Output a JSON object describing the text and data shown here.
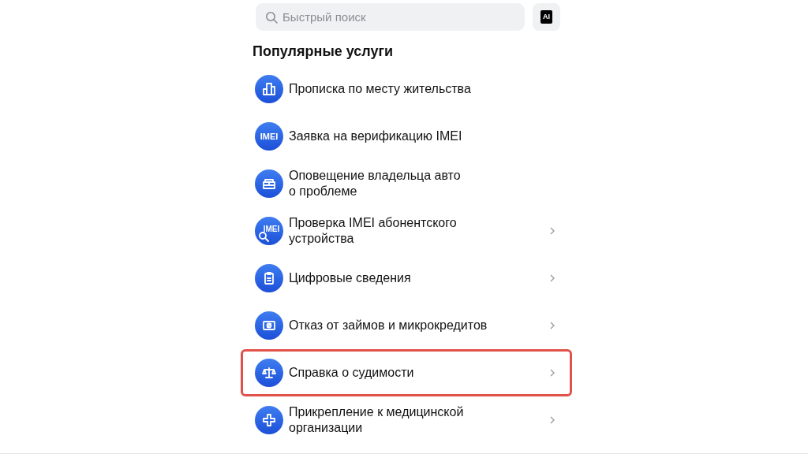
{
  "search": {
    "placeholder": "Быстрый поиск"
  },
  "ai_button": {
    "label": "AI"
  },
  "section_title": "Популярные услуги",
  "services": [
    {
      "lines": [
        "Прописка по месту жительства"
      ],
      "chevron": false,
      "highlighted": false
    },
    {
      "icon_label": "IMEI",
      "lines": [
        "Заявка на верификацию IMEI"
      ],
      "chevron": false,
      "highlighted": false
    },
    {
      "lines": [
        "Оповещение владельца авто",
        "о проблеме"
      ],
      "chevron": false,
      "highlighted": false
    },
    {
      "icon_label": "IMEI",
      "lines": [
        "Проверка IMEI абонентского",
        "устройства"
      ],
      "chevron": true,
      "highlighted": false
    },
    {
      "lines": [
        "Цифровые сведения"
      ],
      "chevron": true,
      "highlighted": false
    },
    {
      "lines": [
        "Отказ от займов и микрокредитов"
      ],
      "chevron": true,
      "highlighted": false
    },
    {
      "lines": [
        "Справка о судимости"
      ],
      "chevron": true,
      "highlighted": true
    },
    {
      "lines": [
        "Прикрепление к медицинской",
        "организации"
      ],
      "chevron": true,
      "highlighted": false
    }
  ]
}
